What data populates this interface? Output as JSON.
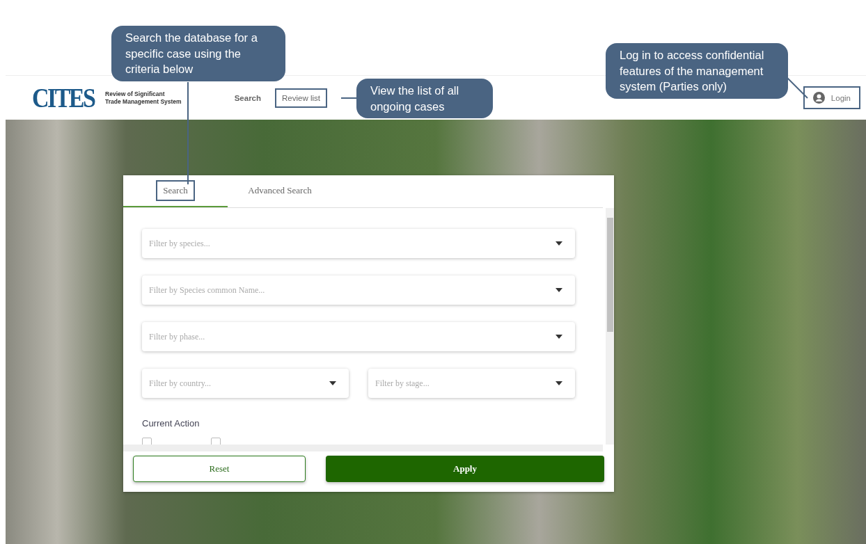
{
  "header": {
    "logo": "CITES",
    "title_lines": [
      "Review of Significant",
      "Trade Management System"
    ],
    "nav": [
      {
        "label": "Search",
        "highlighted": false
      },
      {
        "label": "Review list",
        "highlighted": true
      }
    ],
    "login": {
      "label": "Login",
      "highlighted": true
    }
  },
  "panel": {
    "tabs": [
      {
        "label": "Search",
        "selected": true,
        "highlighted": true
      },
      {
        "label": "Advanced Search",
        "selected": false,
        "highlighted": false
      }
    ],
    "filter_rows": [
      [
        {
          "placeholder": "Filter by species..."
        }
      ],
      [
        {
          "placeholder": "Filter by Species common Name..."
        }
      ],
      [
        {
          "placeholder": "Filter by phase..."
        }
      ],
      [
        {
          "placeholder": "Filter by country..."
        },
        {
          "placeholder": "Filter by stage..."
        }
      ]
    ],
    "section_title": "Current Action",
    "checkboxes": [
      {
        "checked": false
      },
      {
        "checked": false
      }
    ],
    "buttons": [
      {
        "label": "Reset",
        "kind": "outline"
      },
      {
        "label": "Apply",
        "kind": "solid"
      }
    ]
  },
  "callouts": [
    {
      "text": "Search the database for a specific case using the criteria below"
    },
    {
      "text": "View the list of all ongoing cases"
    },
    {
      "text": "Log in to access confidential features of the management system (Parties only)"
    }
  ]
}
